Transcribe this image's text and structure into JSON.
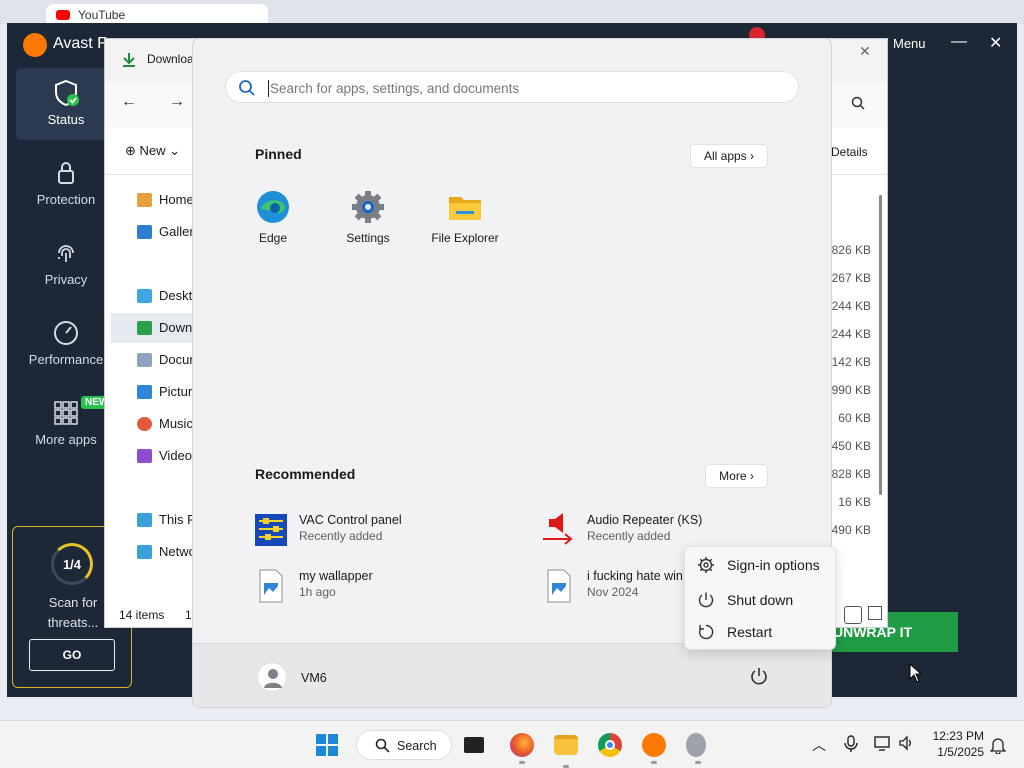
{
  "browser": {
    "tab_title": "YouTube"
  },
  "avast": {
    "title": "Avast F",
    "menu_label": "Menu",
    "nav": [
      {
        "label": "Status"
      },
      {
        "label": "Protection"
      },
      {
        "label": "Privacy"
      },
      {
        "label": "Performance"
      },
      {
        "label": "More apps",
        "badge": "NEW"
      }
    ],
    "scan": {
      "count": "1/4",
      "text": "Scan for threats...",
      "go_label": "GO",
      "progress": 0.25
    },
    "unwrap_label": "UNWRAP IT",
    "accent_color": "#ff7800",
    "unwrap_color": "#1e9b43"
  },
  "explorer": {
    "tab_title": "Downloa",
    "new_label": "New",
    "details_label": "Details",
    "nav_items": [
      {
        "label": "Home"
      },
      {
        "label": "Gallery"
      },
      {
        "label": "Deskto"
      },
      {
        "label": "Downl"
      },
      {
        "label": "Docum"
      },
      {
        "label": "Pictur"
      },
      {
        "label": "Music"
      },
      {
        "label": "Videos"
      },
      {
        "label": "This P"
      },
      {
        "label": "Netwo"
      }
    ],
    "sizes": [
      ",826 KB",
      ",267 KB",
      "244 KB",
      "244 KB",
      "0,142 KB",
      "7,990 KB",
      "60 KB",
      "450 KB",
      "2,828 KB",
      "16 KB",
      "0,490 KB"
    ],
    "status_items": "14 items",
    "status_selected": "1"
  },
  "start_menu": {
    "search_placeholder": "Search for apps, settings, and documents",
    "pinned_title": "Pinned",
    "all_apps_label": "All apps",
    "pinned": [
      {
        "label": "Edge",
        "icon": "edge-icon"
      },
      {
        "label": "Settings",
        "icon": "gear-icon"
      },
      {
        "label": "File Explorer",
        "icon": "folder-icon"
      }
    ],
    "recommended_title": "Recommended",
    "more_label": "More",
    "recommended": [
      {
        "name": "VAC Control panel",
        "sub": "Recently added"
      },
      {
        "name": "Audio Repeater (KS)",
        "sub": "Recently added"
      },
      {
        "name": "my wallapper",
        "sub": "1h ago"
      },
      {
        "name": "i fucking hate win",
        "sub": "Nov 2024"
      }
    ],
    "user_name": "VM6"
  },
  "power_menu": {
    "signin": "Sign-in options",
    "shutdown": "Shut down",
    "restart": "Restart"
  },
  "taskbar": {
    "search_label": "Search",
    "time": "12:23 PM",
    "date": "1/5/2025"
  }
}
